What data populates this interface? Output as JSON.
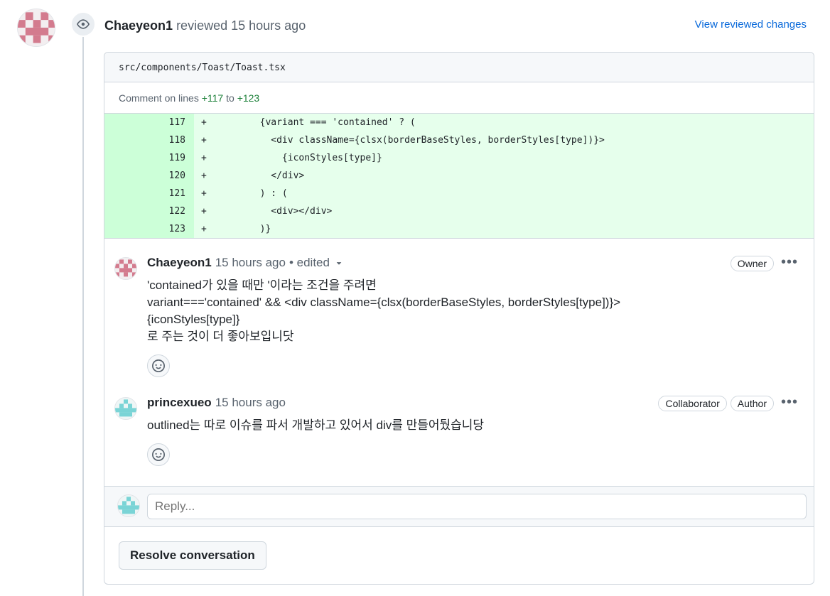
{
  "review": {
    "author": "Chaeyeon1",
    "action": "reviewed",
    "time": "15 hours ago",
    "view_changes": "View reviewed changes"
  },
  "file": {
    "path": "src/components/Toast/Toast.tsx",
    "lines_prefix": "Comment on lines",
    "line_from": "+117",
    "lines_to": "to",
    "line_to": "+123"
  },
  "code_lines": [
    {
      "num": "117",
      "sign": "+",
      "code": "        {variant === 'contained' ? ("
    },
    {
      "num": "118",
      "sign": "+",
      "code": "          <div className={clsx(borderBaseStyles, borderStyles[type])}>"
    },
    {
      "num": "119",
      "sign": "+",
      "code": "            {iconStyles[type]}"
    },
    {
      "num": "120",
      "sign": "+",
      "code": "          </div>"
    },
    {
      "num": "121",
      "sign": "+",
      "code": "        ) : ("
    },
    {
      "num": "122",
      "sign": "+",
      "code": "          <div></div>"
    },
    {
      "num": "123",
      "sign": "+",
      "code": "        )}"
    }
  ],
  "comments": [
    {
      "author": "Chaeyeon1",
      "time": "15 hours ago",
      "edited": "• edited",
      "badges": [
        "Owner"
      ],
      "body_lines": [
        "'contained가 있을 때만 '이라는 조건을 주려면",
        "variant==='contained' && <div className={clsx(borderBaseStyles, borderStyles[type])}>",
        "{iconStyles[type]}",
        "로 주는 것이 더 좋아보입니닷"
      ]
    },
    {
      "author": "princexueo",
      "time": "15 hours ago",
      "badges": [
        "Collaborator",
        "Author"
      ],
      "body_lines": [
        "outlined는 따로 이슈를 파서 개발하고 있어서 div를 만들어뒀습니당"
      ]
    }
  ],
  "reply": {
    "placeholder": "Reply..."
  },
  "resolve_label": "Resolve conversation",
  "icons": {
    "eye": "eye-icon",
    "smiley": "smiley-icon",
    "kebab": "kebab-horizontal-icon",
    "caret": "triangle-down-icon"
  },
  "colors": {
    "link": "#0969da",
    "added_bg": "#e6ffec",
    "added_num_bg": "#ccffd8",
    "avatar_pink": "#d37b8e",
    "avatar_teal": "#7ad4d6"
  }
}
